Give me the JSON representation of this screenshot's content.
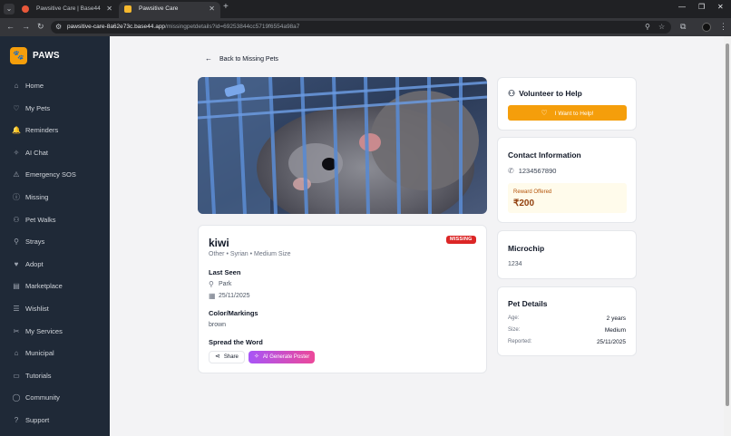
{
  "browser": {
    "tabs": [
      {
        "title": "Pawsitive Care | Base44",
        "active": false,
        "favicon_color": "#e8583a"
      },
      {
        "title": "Pawsitive Care",
        "active": true,
        "favicon_color": "#f5b82e"
      }
    ],
    "url_host": "pawsitive-care-8a62e73c.base44.app",
    "url_path": "/missingpetdetails?id=69253844cc5719f6554a98a7"
  },
  "sidebar": {
    "brand": "PAWS",
    "items": [
      {
        "label": "Home",
        "icon": "home-icon",
        "glyph": "⌂"
      },
      {
        "label": "My Pets",
        "icon": "heart-icon",
        "glyph": "♡"
      },
      {
        "label": "Reminders",
        "icon": "bell-icon",
        "glyph": "🔔"
      },
      {
        "label": "AI Chat",
        "icon": "sparkle-icon",
        "glyph": "✧"
      },
      {
        "label": "Emergency SOS",
        "icon": "warning-icon",
        "glyph": "⚠"
      },
      {
        "label": "Missing",
        "icon": "alert-circle-icon",
        "glyph": "ⓘ"
      },
      {
        "label": "Pet Walks",
        "icon": "users-icon",
        "glyph": "⚇"
      },
      {
        "label": "Strays",
        "icon": "map-pin-icon",
        "glyph": "⚲"
      },
      {
        "label": "Adopt",
        "icon": "heart-handshake-icon",
        "glyph": "♥"
      },
      {
        "label": "Marketplace",
        "icon": "store-icon",
        "glyph": "▤"
      },
      {
        "label": "Wishlist",
        "icon": "list-icon",
        "glyph": "☰"
      },
      {
        "label": "My Services",
        "icon": "scissors-icon",
        "glyph": "✂"
      },
      {
        "label": "Municipal",
        "icon": "building-icon",
        "glyph": "⌂"
      },
      {
        "label": "Tutorials",
        "icon": "book-icon",
        "glyph": "▭"
      },
      {
        "label": "Community",
        "icon": "message-icon",
        "glyph": "◯"
      },
      {
        "label": "Support",
        "icon": "help-icon",
        "glyph": "?"
      }
    ]
  },
  "main": {
    "back_label": "Back to Missing Pets",
    "pet": {
      "name": "kiwi",
      "subtitle": "Other • Syrian • Medium Size",
      "status": "MISSING",
      "last_seen_heading": "Last Seen",
      "location": "Park",
      "date": "25/11/2025",
      "color_heading": "Color/Markings",
      "color_value": "brown",
      "spread_heading": "Spread the Word",
      "share_label": "Share",
      "ai_poster_label": "AI Generate Poster"
    },
    "volunteer": {
      "title": "Volunteer to Help",
      "button_label": "I Want to Help!"
    },
    "contact": {
      "title": "Contact Information",
      "phone": "1234567890",
      "reward_label": "Reward Offered",
      "reward_value": "₹200"
    },
    "microchip": {
      "title": "Microchip",
      "value": "1234"
    },
    "details": {
      "title": "Pet Details",
      "rows": [
        {
          "label": "Age:",
          "value": "2 years"
        },
        {
          "label": "Size:",
          "value": "Medium"
        },
        {
          "label": "Reported:",
          "value": "25/11/2025"
        }
      ]
    }
  },
  "colors": {
    "sidebar_bg": "#1f2937",
    "accent": "#f59e0b",
    "missing_badge": "#dc2626",
    "ai_gradient_start": "#a855f7",
    "ai_gradient_end": "#ec4899"
  }
}
